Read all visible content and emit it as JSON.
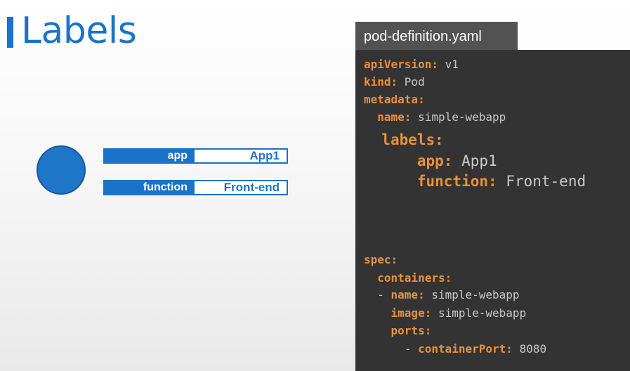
{
  "slide": {
    "title": "Labels"
  },
  "pod": {
    "labels": [
      {
        "key": "app",
        "value": "App1"
      },
      {
        "key": "function",
        "value": "Front-end"
      }
    ]
  },
  "file": {
    "name": "pod-definition.yaml",
    "lines": [
      {
        "indent": "",
        "dash": "",
        "key": "apiVersion",
        "value": "v1"
      },
      {
        "indent": "",
        "dash": "",
        "key": "kind",
        "value": "Pod"
      },
      {
        "indent": "",
        "dash": "",
        "key": "metadata",
        "value": ""
      },
      {
        "indent": "  ",
        "dash": "",
        "key": "name",
        "value": "simple-webapp"
      },
      {
        "indent": "  ",
        "dash": "",
        "key": "labels",
        "value": ""
      },
      {
        "indent": "      ",
        "dash": "",
        "key": "app",
        "value": "App1"
      },
      {
        "indent": "      ",
        "dash": "",
        "key": "function",
        "value": "Front-end"
      },
      {
        "indent": "",
        "dash": "",
        "key": "spec",
        "value": ""
      },
      {
        "indent": "  ",
        "dash": "",
        "key": "containers",
        "value": ""
      },
      {
        "indent": "  ",
        "dash": "- ",
        "key": "name",
        "value": "simple-webapp"
      },
      {
        "indent": "    ",
        "dash": "",
        "key": "image",
        "value": "simple-webapp"
      },
      {
        "indent": "    ",
        "dash": "",
        "key": "ports",
        "value": ""
      },
      {
        "indent": "      ",
        "dash": "- ",
        "key": "containerPort",
        "value": "8080"
      }
    ]
  },
  "colors": {
    "accent": "#1a73c9",
    "code_key": "#e8913d",
    "code_text": "#c9c9c9",
    "code_bg": "#333333",
    "tab_bg": "#525252"
  }
}
